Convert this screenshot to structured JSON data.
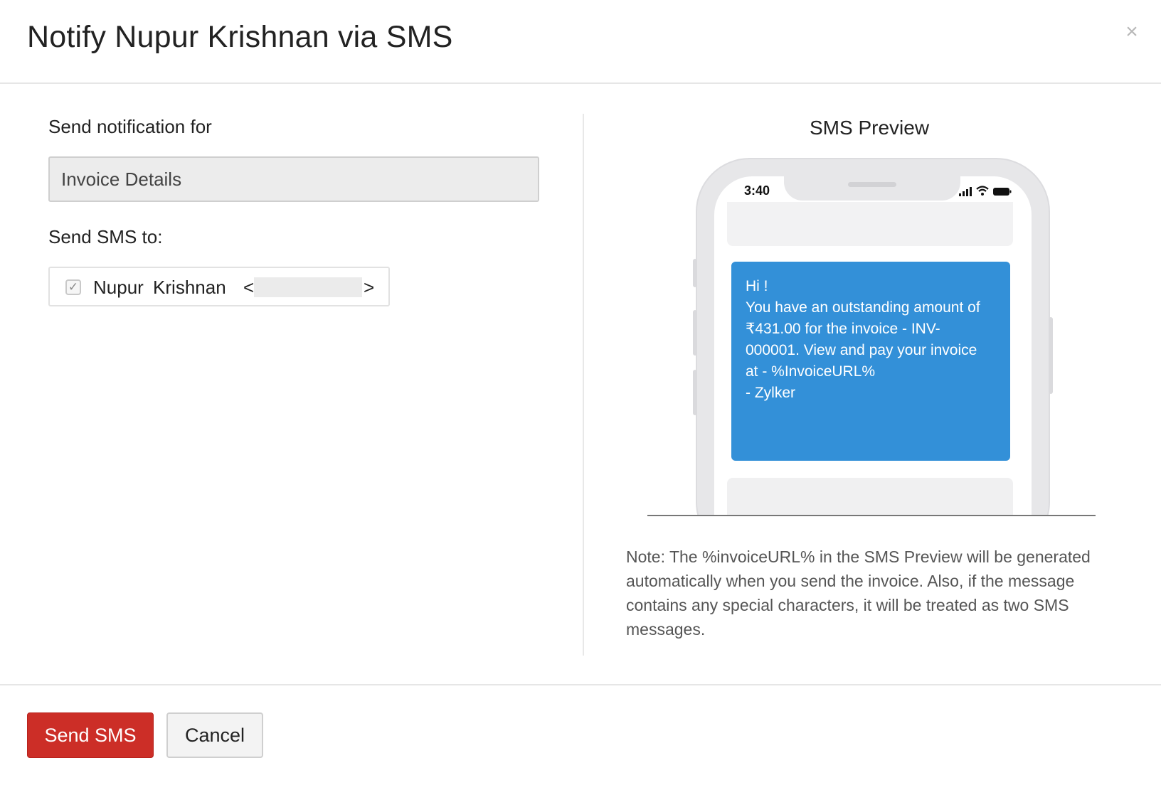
{
  "dialog": {
    "title": "Notify Nupur Krishnan via SMS",
    "close_icon": "×"
  },
  "form": {
    "notify_label": "Send notification for",
    "notify_value": "Invoice Details",
    "sms_to_label": "Send SMS to:",
    "recipient": {
      "checked": true,
      "check_glyph": "✓",
      "name": "Nupur Krishnan",
      "open_bracket": "<",
      "close_bracket": ">"
    }
  },
  "preview": {
    "title": "SMS Preview",
    "phone_time": "3:40",
    "message_lines": [
      "Hi !",
      "You have an outstanding amount of",
      "₹431.00 for the invoice - INV-",
      "000001. View and pay your invoice",
      "at - %InvoiceURL%",
      "- Zylker"
    ],
    "bubble_color": "#3390d8"
  },
  "note": "Note: The %invoiceURL% in the SMS Preview will be generated automatically when you send the invoice.  Also, if the message contains any special characters, it will be treated as two SMS messages.",
  "footer": {
    "send_label": "Send SMS",
    "cancel_label": "Cancel"
  },
  "colors": {
    "primary_button": "#cc2e27",
    "divider": "#e6e6e6"
  }
}
